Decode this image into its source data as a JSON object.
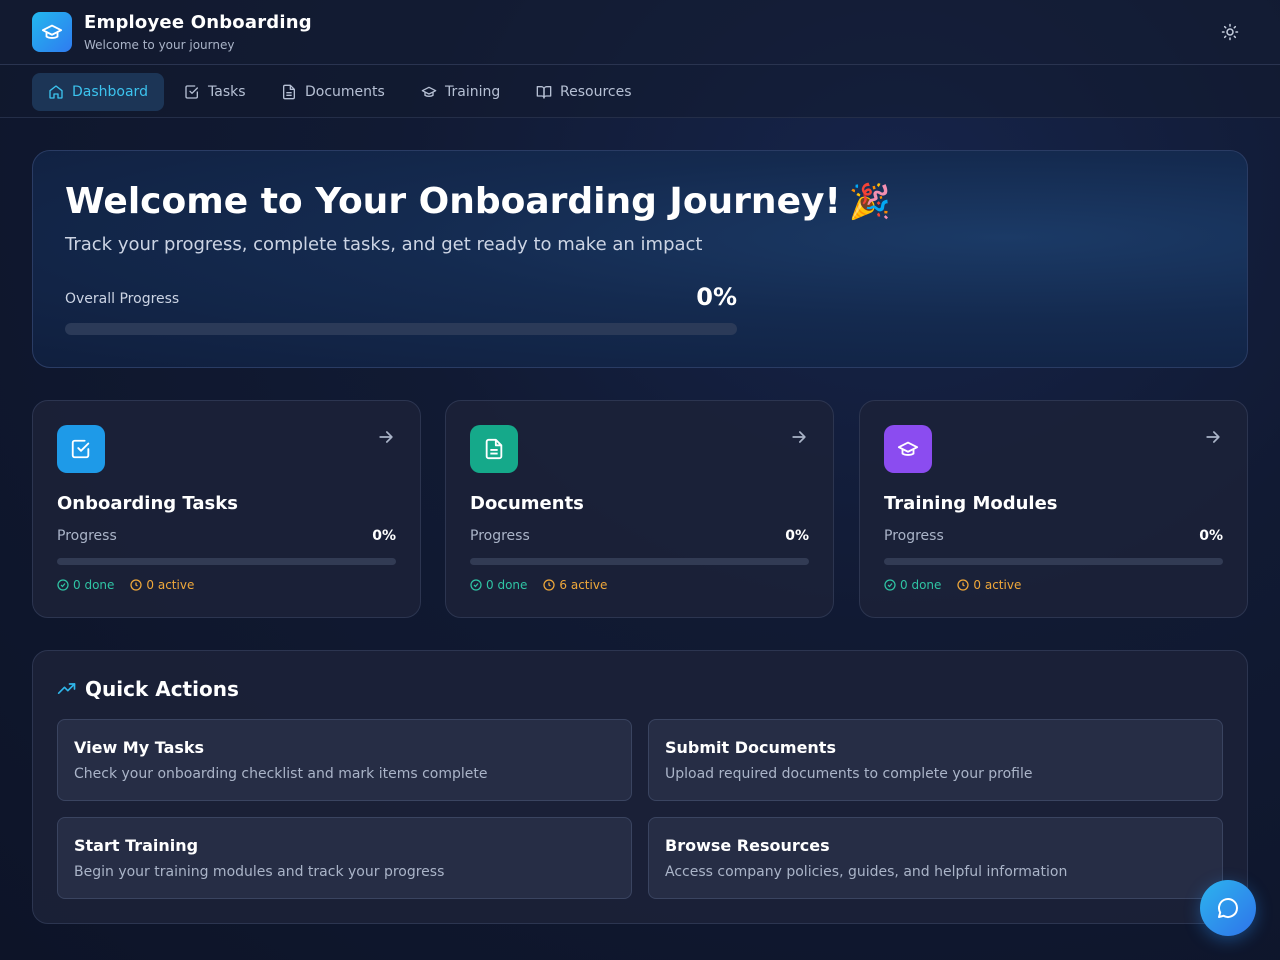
{
  "header": {
    "title": "Employee Onboarding",
    "subtitle": "Welcome to your journey",
    "logo_icon": "graduation-cap-icon",
    "theme_icon": "sun-icon"
  },
  "nav": {
    "items": [
      {
        "label": "Dashboard",
        "icon": "home-icon",
        "active": true
      },
      {
        "label": "Tasks",
        "icon": "checkbox-icon",
        "active": false
      },
      {
        "label": "Documents",
        "icon": "document-icon",
        "active": false
      },
      {
        "label": "Training",
        "icon": "graduation-cap-icon",
        "active": false
      },
      {
        "label": "Resources",
        "icon": "book-icon",
        "active": false
      }
    ]
  },
  "hero": {
    "title": "Welcome to Your Onboarding Journey!",
    "emoji": "🎉",
    "subtitle": "Track your progress, complete tasks, and get ready to make an impact",
    "progress_label": "Overall Progress",
    "progress_value": "0%",
    "progress_fraction": 0
  },
  "cards": [
    {
      "title": "Onboarding Tasks",
      "icon": "checkbox-icon",
      "color": "#1e9ae8",
      "progress_label": "Progress",
      "progress_value": "0%",
      "progress_fraction": 0,
      "done": "0 done",
      "active": "0 active"
    },
    {
      "title": "Documents",
      "icon": "document-icon",
      "color": "#15a98a",
      "progress_label": "Progress",
      "progress_value": "0%",
      "progress_fraction": 0,
      "done": "0 done",
      "active": "6 active"
    },
    {
      "title": "Training Modules",
      "icon": "graduation-cap-icon",
      "color": "#8b4cf0",
      "progress_label": "Progress",
      "progress_value": "0%",
      "progress_fraction": 0,
      "done": "0 done",
      "active": "0 active"
    }
  ],
  "quick_actions": {
    "title": "Quick Actions",
    "icon": "trending-up-icon",
    "items": [
      {
        "title": "View My Tasks",
        "description": "Check your onboarding checklist and mark items complete"
      },
      {
        "title": "Submit Documents",
        "description": "Upload required documents to complete your profile"
      },
      {
        "title": "Start Training",
        "description": "Begin your training modules and track your progress"
      },
      {
        "title": "Browse Resources",
        "description": "Access company policies, guides, and helpful information"
      }
    ]
  },
  "chat": {
    "icon": "chat-icon"
  },
  "colors": {
    "accent": "#2fb6ea",
    "done": "#2fc4a4",
    "active": "#f0a83a",
    "background": "#111a33"
  }
}
